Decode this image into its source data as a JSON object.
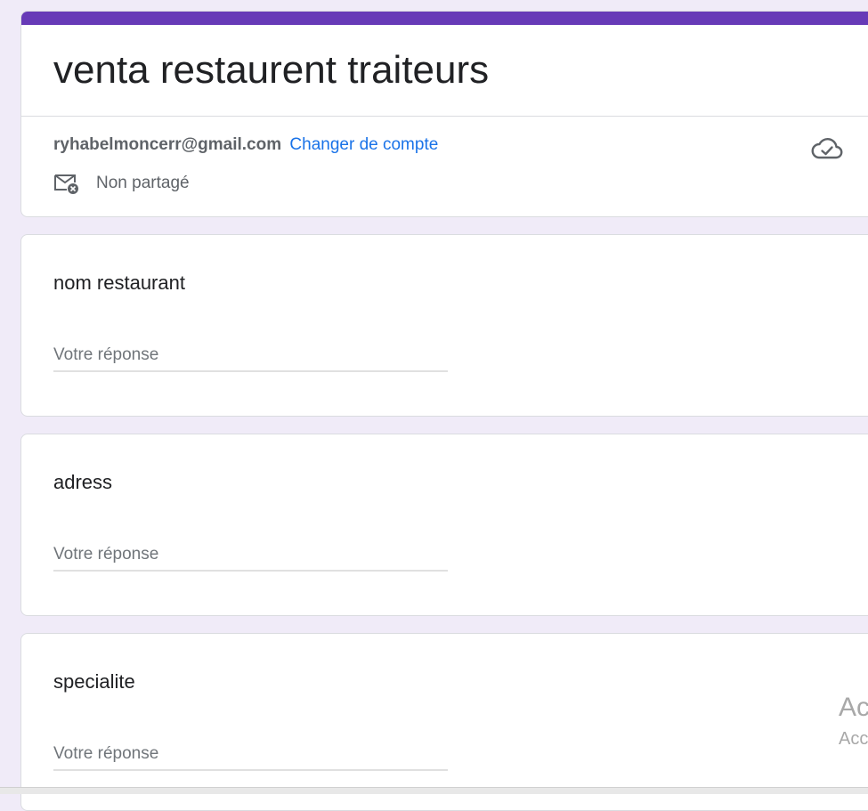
{
  "form": {
    "title": "venta restaurent traiteurs",
    "accent_color": "#673ab7"
  },
  "account": {
    "email": "ryhabelmoncerr@gmail.com",
    "switch_label": "Changer de compte",
    "share_status": "Non partagé",
    "share_icon": "mail-not-shared-icon",
    "sync_icon": "cloud-done-icon"
  },
  "questions": [
    {
      "title": "nom restaurant",
      "placeholder": "Votre réponse"
    },
    {
      "title": "adress",
      "placeholder": "Votre réponse"
    },
    {
      "title": "specialite",
      "placeholder": "Votre réponse"
    }
  ],
  "watermark": {
    "line1": "Ac",
    "line2": "Acc"
  }
}
